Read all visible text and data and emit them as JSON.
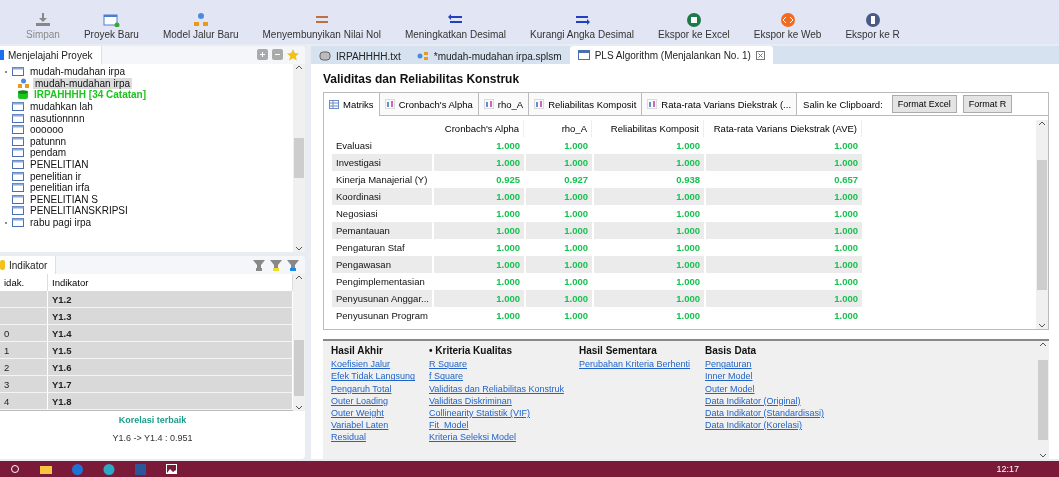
{
  "toolbar": [
    {
      "label": "Simpan",
      "disabled": true
    },
    {
      "label": "Proyek Baru",
      "disabled": false
    },
    {
      "label": "Model Jalur Baru",
      "disabled": false
    },
    {
      "label": "Menyembunyikan Nilai Nol",
      "disabled": false
    },
    {
      "label": "Meningkatkan Desimal",
      "disabled": false
    },
    {
      "label": "Kurangi Angka Desimal",
      "disabled": false
    },
    {
      "label": "Ekspor ke Excel",
      "disabled": false
    },
    {
      "label": "Ekspor ke Web",
      "disabled": false
    },
    {
      "label": "Ekspor ke R",
      "disabled": false
    }
  ],
  "explorer": {
    "tab": "Menjelajahi Proyek",
    "items": [
      {
        "label": "mudah-mudahan irpa",
        "kind": "project",
        "expanded": true,
        "selected": false,
        "children": [
          {
            "label": "mudah-mudahan irpa",
            "kind": "model",
            "selected": true
          },
          {
            "label": "IRPAHHHH [34 Catatan]",
            "kind": "data",
            "selected": false
          }
        ]
      },
      {
        "label": "mudahkan lah",
        "kind": "project",
        "expanded": false,
        "selected": false
      },
      {
        "label": "nasutionnnn",
        "kind": "project",
        "expanded": false,
        "selected": false
      },
      {
        "label": "oooooo",
        "kind": "project",
        "expanded": false,
        "selected": false
      },
      {
        "label": "patunnn",
        "kind": "project",
        "expanded": false,
        "selected": false
      },
      {
        "label": "pendam",
        "kind": "project",
        "expanded": false,
        "selected": false
      },
      {
        "label": "PENELITIAN",
        "kind": "project",
        "expanded": false,
        "selected": false
      },
      {
        "label": "penelitian ir",
        "kind": "project",
        "expanded": false,
        "selected": false
      },
      {
        "label": "penelitian irfa",
        "kind": "project",
        "expanded": false,
        "selected": false
      },
      {
        "label": "PENELITIAN S",
        "kind": "project",
        "expanded": false,
        "selected": false
      },
      {
        "label": "PENELITIANSKRIPSI",
        "kind": "project",
        "expanded": false,
        "selected": false
      },
      {
        "label": "rabu pagi irpa",
        "kind": "project",
        "expanded": true,
        "selected": false
      }
    ]
  },
  "indicators": {
    "tab": "Indikator",
    "columns": [
      "idak.",
      "Indikator"
    ],
    "rows": [
      [
        "",
        "Y1.2"
      ],
      [
        "",
        "Y1.3"
      ],
      [
        "0",
        "Y1.4"
      ],
      [
        "1",
        "Y1.5"
      ],
      [
        "2",
        "Y1.6"
      ],
      [
        "3",
        "Y1.7"
      ],
      [
        "4",
        "Y1.8"
      ]
    ],
    "footer_title": "Korelasi terbaik",
    "footer_value": "Y1.6 -> Y1.4 : 0.951"
  },
  "editor_tabs": [
    {
      "label": "IRPAHHHH.txt",
      "selected": false
    },
    {
      "label": "*mudah-mudahan irpa.splsm",
      "selected": false
    },
    {
      "label": "PLS Algorithm (Menjalankan No. 1)",
      "selected": true
    }
  ],
  "report": {
    "title": "Validitas dan Reliabilitas Konstruk",
    "tabs": [
      {
        "label": "Matriks",
        "selected": true
      },
      {
        "label": "Cronbach's Alpha",
        "selected": false
      },
      {
        "label": "rho_A",
        "selected": false
      },
      {
        "label": "Reliabilitas Komposit",
        "selected": false
      },
      {
        "label": "Rata-rata Varians Diekstrak (...",
        "selected": false
      }
    ],
    "clipboard_label": "Salin ke Clipboard:",
    "buttons": [
      "Format Excel",
      "Format R"
    ],
    "columns": [
      "Cronbach's Alpha",
      "rho_A",
      "Reliabilitas Komposit",
      "Rata-rata Varians Diekstrak (AVE)"
    ],
    "rows": [
      {
        "name": "Evaluasi",
        "values": [
          "1.000",
          "1.000",
          "1.000",
          "1.000"
        ]
      },
      {
        "name": "Investigasi",
        "values": [
          "1.000",
          "1.000",
          "1.000",
          "1.000"
        ]
      },
      {
        "name": "Kinerja Manajerial (Y)",
        "values": [
          "0.925",
          "0.927",
          "0.938",
          "0.657"
        ]
      },
      {
        "name": "Koordinasi",
        "values": [
          "1.000",
          "1.000",
          "1.000",
          "1.000"
        ]
      },
      {
        "name": "Negosiasi",
        "values": [
          "1.000",
          "1.000",
          "1.000",
          "1.000"
        ]
      },
      {
        "name": "Pemantauan",
        "values": [
          "1.000",
          "1.000",
          "1.000",
          "1.000"
        ]
      },
      {
        "name": "Pengaturan Staf",
        "values": [
          "1.000",
          "1.000",
          "1.000",
          "1.000"
        ]
      },
      {
        "name": "Pengawasan",
        "values": [
          "1.000",
          "1.000",
          "1.000",
          "1.000"
        ]
      },
      {
        "name": "Pengimplementasian",
        "values": [
          "1.000",
          "1.000",
          "1.000",
          "1.000"
        ]
      },
      {
        "name": "Penyusunan Anggar...",
        "values": [
          "1.000",
          "1.000",
          "1.000",
          "1.000"
        ]
      },
      {
        "name": "Penyusunan Program",
        "values": [
          "1.000",
          "1.000",
          "1.000",
          "1.000"
        ]
      }
    ]
  },
  "navigator": [
    {
      "title": "Hasil Akhir",
      "links": [
        "Koefisien Jalur",
        "Efek Tidak Langsung",
        "Pengaruh Total",
        "Outer Loading",
        "Outer Weight",
        "Variabel Laten",
        "Residual"
      ]
    },
    {
      "title": "• Kriteria Kualitas",
      "links": [
        "R Square",
        "f Square",
        "Validitas dan Reliabilitas Konstruk",
        "Validitas Diskriminan",
        "Collinearity Statistik (VIF)",
        "Fit_Model",
        "Kriteria Seleksi Model"
      ]
    },
    {
      "title": "Hasil Sementara",
      "links": [
        "Perubahan Kriteria Berhenti"
      ]
    },
    {
      "title": "Basis Data",
      "links": [
        "Pengaturan",
        "Inner Model",
        "Outer Model",
        "Data Indikator (Original)",
        "Data Indikator (Standardisasi)",
        "Data Indikator (Korelasi)"
      ]
    }
  ],
  "taskbar": {
    "clock": "12:17"
  }
}
